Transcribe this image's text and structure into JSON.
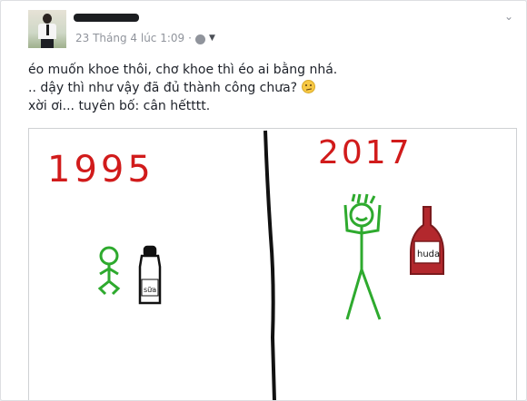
{
  "post": {
    "author_name": "",
    "timestamp": "23 Tháng 4 lúc 1:09",
    "privacy_separator": "·",
    "text_lines": [
      "éo muốn khoe thôi, chơ khoe thì éo ai bằng nhá.",
      ".. dậy thì như vậy đã đủ thành công chưa?",
      "xời ơi... tuyên bố: cân hếtttt."
    ],
    "emoji": "confused-face"
  },
  "drawing": {
    "year_left": "1995",
    "year_right": "2017",
    "bottle_left_label": "sữa",
    "bottle_right_label": "huda",
    "colors": {
      "year": "#d11b1b",
      "figure": "#2eaa2e",
      "divider": "#111111",
      "bottle_right": "#b3282d"
    }
  },
  "icons": {
    "globe": "globe-icon",
    "caret": "caret-down-icon",
    "options": "chevron-down-icon"
  }
}
